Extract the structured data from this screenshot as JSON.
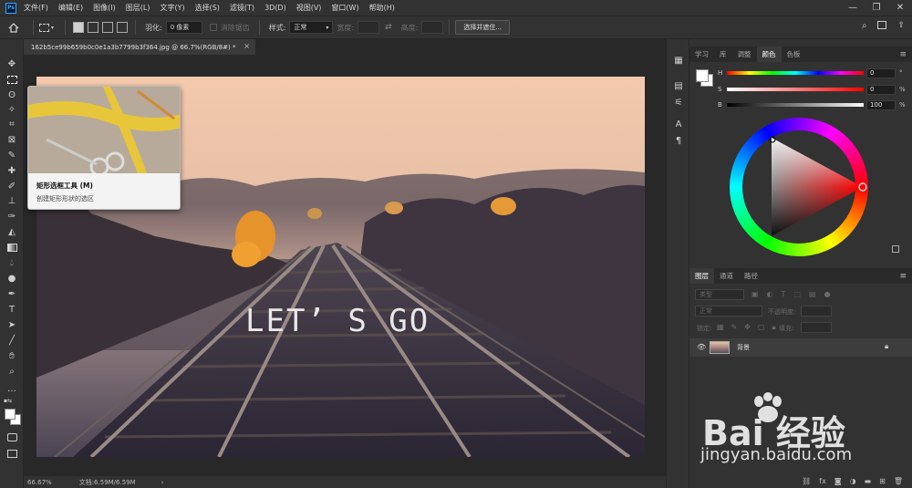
{
  "app": {
    "logo": "Ps"
  },
  "menubar": {
    "items": [
      "文件(F)",
      "编辑(E)",
      "图像(I)",
      "图层(L)",
      "文字(Y)",
      "选择(S)",
      "滤镜(T)",
      "3D(D)",
      "视图(V)",
      "窗口(W)",
      "帮助(H)"
    ],
    "window_controls": [
      "—",
      "❐",
      "✕"
    ]
  },
  "options": {
    "feather_label": "羽化:",
    "feather_value": "0 像素",
    "antialias_label": "消除锯齿",
    "style_label": "样式:",
    "style_value": "正常",
    "width_label": "宽度:",
    "height_label": "高度:",
    "select_mask_button": "选择并遮住..."
  },
  "document": {
    "tab_title": "162b5ce99b659b0c0e1a3b7799b3f364.jpg @ 66.7%(RGB/8#) *",
    "tab_close": "×",
    "overlay_text": "LET’ S GO"
  },
  "tooltip": {
    "title": "矩形选框工具 (M)",
    "description": "创建矩形形状的选区"
  },
  "status": {
    "zoom": "66.67%",
    "doc_size": "文档:6.59M/6.59M",
    "arrow": "›"
  },
  "color_panel": {
    "tabs": [
      "学习",
      "库",
      "调整",
      "颜色",
      "色板"
    ],
    "active_tab": "颜色",
    "sliders": [
      {
        "letter": "H",
        "value": "0",
        "unit": "°"
      },
      {
        "letter": "S",
        "value": "0",
        "unit": "%"
      },
      {
        "letter": "B",
        "value": "100",
        "unit": "%"
      }
    ]
  },
  "layers_panel": {
    "tabs": [
      "图层",
      "通道",
      "路径"
    ],
    "active_tab": "图层",
    "filter_placeholder": "类型",
    "blend_mode": "正常",
    "opacity_label": "不透明度:",
    "lock_label": "锁定:",
    "fill_label": "填充:",
    "layer_name": "背景"
  },
  "watermark": {
    "line1": "Bai 经验",
    "line2": "jingyan.baidu.com"
  },
  "colors": {
    "ui_bg": "#323232",
    "canvas_bg": "#282828",
    "accent": "#31a8ff"
  }
}
